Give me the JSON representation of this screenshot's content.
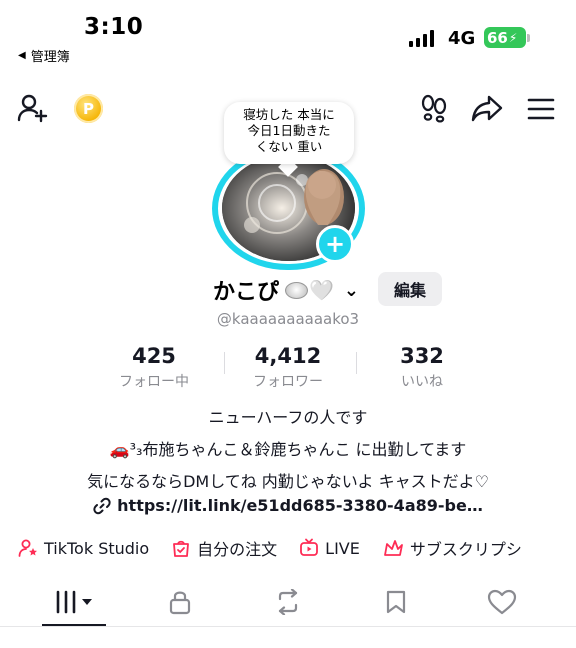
{
  "status_bar": {
    "time": "3:10",
    "back_label": "管理簿",
    "network": "4G",
    "battery": "66"
  },
  "top_nav": {
    "coin_symbol": "P"
  },
  "note_bubble": {
    "line1": "寝坊した 本当に",
    "line2": "今日1日動きた",
    "line3": "くない 重い"
  },
  "profile": {
    "display_name": "かこぴ",
    "name_emoji_heart": "🤍",
    "edit_label": "編集",
    "username": "@kaaaaaaaaaako3"
  },
  "stats": [
    {
      "value": "425",
      "label": "フォロー中"
    },
    {
      "value": "4,412",
      "label": "フォロワー"
    },
    {
      "value": "332",
      "label": "いいね"
    }
  ],
  "bio": {
    "line1": "ニューハーフの人です",
    "line2": "🚗³₃布施ちゃんこ＆鈴鹿ちゃんこ に出勤してます",
    "line3": "気になるならDMしてね 内勤じゃないよ キャストだよ♡",
    "link": "https://lit.link/e51dd685-3380-4a89-be…"
  },
  "shortcuts": [
    {
      "label": "TikTok Studio",
      "icon": "person-star-icon"
    },
    {
      "label": "自分の注文",
      "icon": "order-bag-icon"
    },
    {
      "label": "LIVE",
      "icon": "tv-icon"
    },
    {
      "label": "サブスクリプシ",
      "icon": "subscription-icon"
    }
  ],
  "tabs": [
    "videos-grid",
    "private-lock",
    "reposts",
    "favorites",
    "liked"
  ],
  "colors": {
    "accent": "#fe2c55",
    "ring": "#20d5ec",
    "battery": "#34c759",
    "text": "#161823",
    "muted": "#8a8b91"
  }
}
